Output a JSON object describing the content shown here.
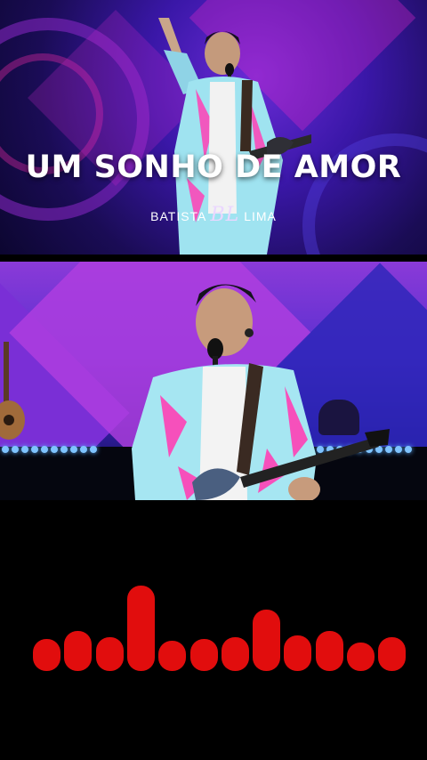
{
  "thumbnail": {
    "title": "UM SONHO DE AMOR",
    "logo_left": "BATISTA",
    "logo_mark": "BL",
    "logo_right": "LIMA"
  },
  "visualizer": {
    "color": "#e10d0d",
    "levels": [
      0.37,
      0.47,
      0.4,
      1.0,
      0.35,
      0.37,
      0.4,
      0.72,
      0.42,
      0.47,
      0.33,
      0.4
    ]
  }
}
